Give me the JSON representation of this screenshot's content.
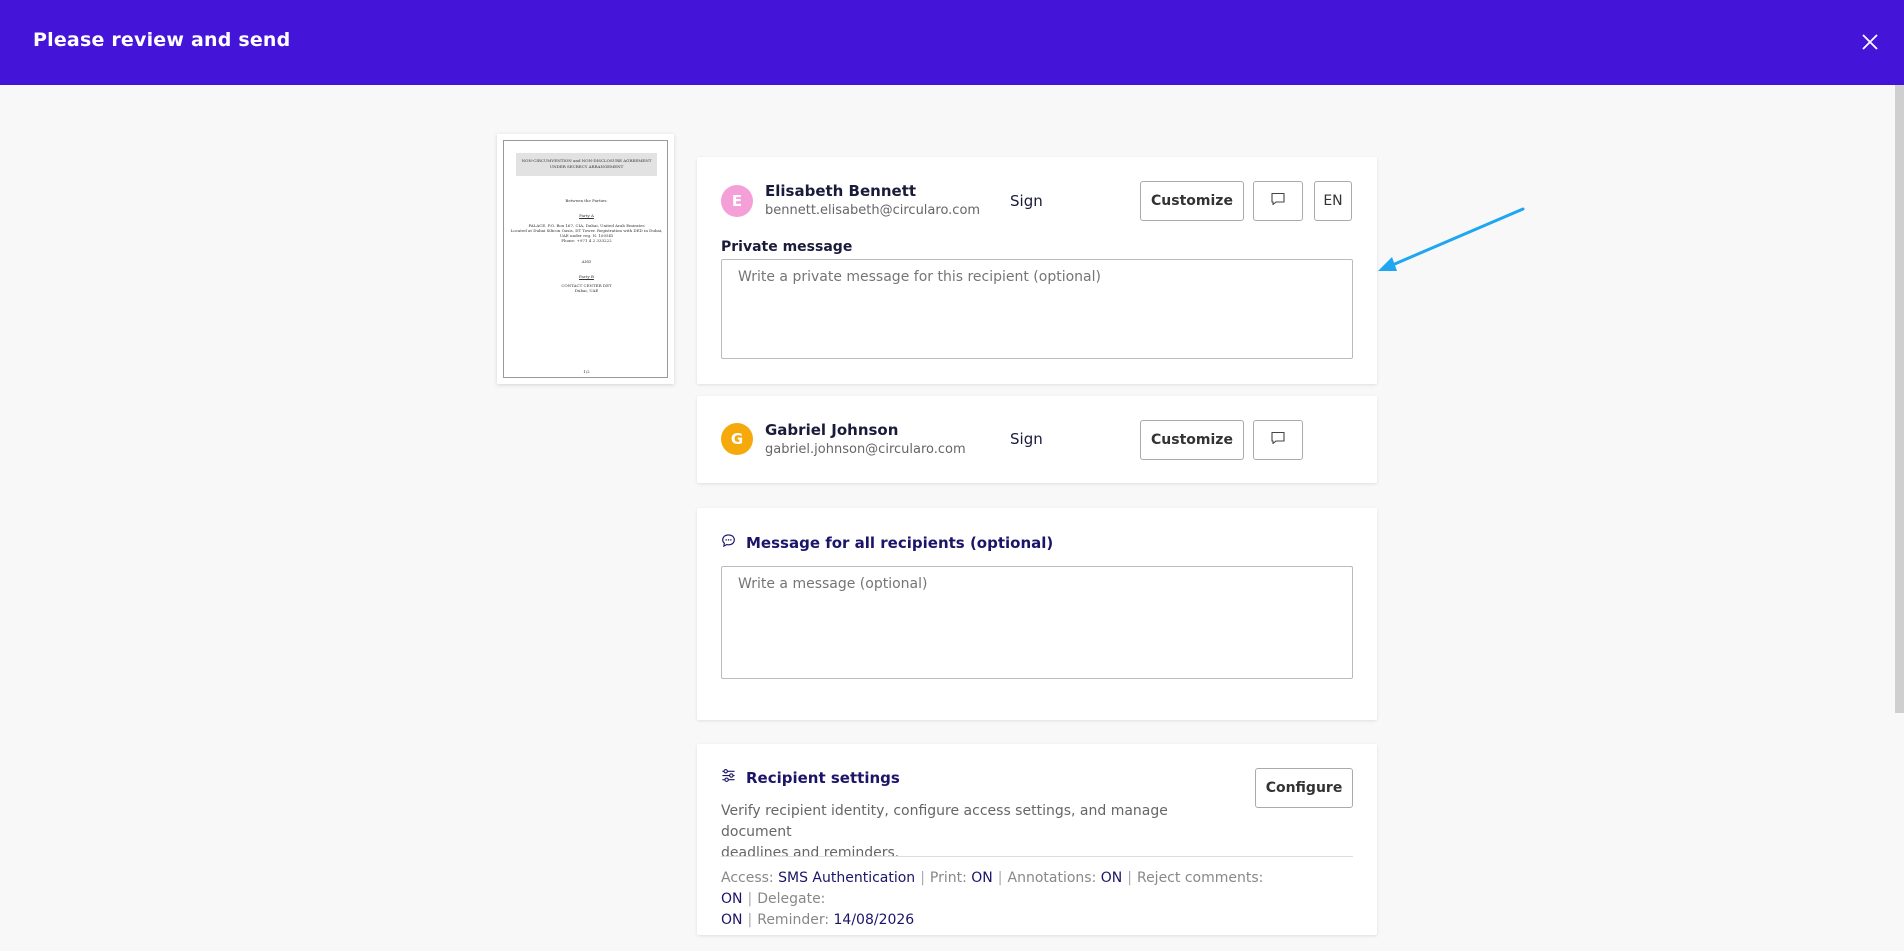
{
  "header": {
    "title": "Please review and send",
    "bg_color": "#4514d9",
    "close_icon": "close-icon"
  },
  "document_thumbnail": {
    "lines": [
      "NON-CIRCUMVENTION and NON-DISCLOSURE AGREEMENT",
      "UNDER SECRECY ARRANGEMENT",
      "Between the Parties:",
      "Party A",
      "PALACE, P.O. Box 167, CIA, Dubai, United Arab Emirates",
      "Located at Dubai Silicon Oasis, DT Tower. Registration with DED in Dubai,",
      "UAE under reg. N. 1005ID",
      "Phone: +971 4 2 333222",
      "AND",
      "Party B",
      "CONTACT CENTER DET",
      "Dubai, UAE",
      "1/2"
    ]
  },
  "recipients": [
    {
      "initial": "E",
      "avatar_color": "#f59fd9",
      "name": "Elisabeth Bennett",
      "email": "bennett.elisabeth@circularo.com",
      "role": "Sign",
      "customize_label": "Customize",
      "message_icon": "chat-bubble-icon",
      "language": "EN",
      "private_message_label": "Private message",
      "private_message_placeholder": "Write a private message for this recipient (optional)"
    },
    {
      "initial": "G",
      "avatar_color": "#f5a90a",
      "name": "Gabriel Johnson",
      "email": "gabriel.johnson@circularo.com",
      "role": "Sign",
      "customize_label": "Customize",
      "message_icon": "chat-bubble-icon"
    }
  ],
  "message_all": {
    "icon": "chat-bubble-icon",
    "title": "Message for all recipients (optional)",
    "placeholder": "Write a message (optional)"
  },
  "recipient_settings": {
    "icon": "sliders-icon",
    "title": "Recipient settings",
    "configure_label": "Configure",
    "description_line1": "Verify recipient identity, configure access settings, and manage document",
    "description_line2": "deadlines and reminders.",
    "summary": {
      "access_label": "Access:",
      "access_value": "SMS Authentication",
      "print_label": "Print:",
      "print_value": "ON",
      "annotations_label": "Annotations:",
      "annotations_value": "ON",
      "reject_label": "Reject comments:",
      "reject_value": "ON",
      "delegate_label": "Delegate:",
      "delegate_value": "ON",
      "reminder_label": "Reminder:",
      "reminder_value": "14/08/2026",
      "separator": "|"
    }
  },
  "annotation_arrow": {
    "color": "#1ea7f0",
    "icon": "arrow-icon"
  }
}
